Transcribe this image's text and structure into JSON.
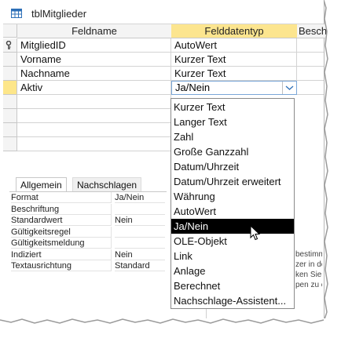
{
  "window": {
    "title": "tblMitglieder",
    "table_icon": "table-icon"
  },
  "grid": {
    "headers": [
      "Feldname",
      "Felddatentyp",
      "Beschr"
    ],
    "rows": [
      {
        "name": "MitgliedID",
        "type": "AutoWert",
        "primary_key": true
      },
      {
        "name": "Vorname",
        "type": "Kurzer Text"
      },
      {
        "name": "Nachname",
        "type": "Kurzer Text"
      },
      {
        "name": "Aktiv",
        "type": "Ja/Nein",
        "current": true
      }
    ],
    "selected_header_color": "#fce58f"
  },
  "dropdown": {
    "items": [
      "Kurzer Text",
      "Langer Text",
      "Zahl",
      "Große Ganzzahl",
      "Datum/Uhrzeit",
      "Datum/Uhrzeit erweitert",
      "Währung",
      "AutoWert",
      "Ja/Nein",
      "OLE-Objekt",
      "Link",
      "Anlage",
      "Berechnet",
      "Nachschlage-Assistent..."
    ],
    "selected": "Ja/Nein"
  },
  "properties": {
    "tabs": [
      "Allgemein",
      "Nachschlagen"
    ],
    "rows": [
      {
        "label": "Format",
        "value": "Ja/Nein"
      },
      {
        "label": "Beschriftung",
        "value": ""
      },
      {
        "label": "Standardwert",
        "value": "Nein"
      },
      {
        "label": "Gültigkeitsregel",
        "value": ""
      },
      {
        "label": "Gültigkeitsmeldung",
        "value": ""
      },
      {
        "label": "Indiziert",
        "value": "Nein"
      },
      {
        "label": "Textausrichtung",
        "value": "Standard"
      }
    ]
  },
  "help": {
    "lines": [
      "bestimm",
      "zer in de",
      "ken Sie F",
      "pen zu e"
    ]
  }
}
